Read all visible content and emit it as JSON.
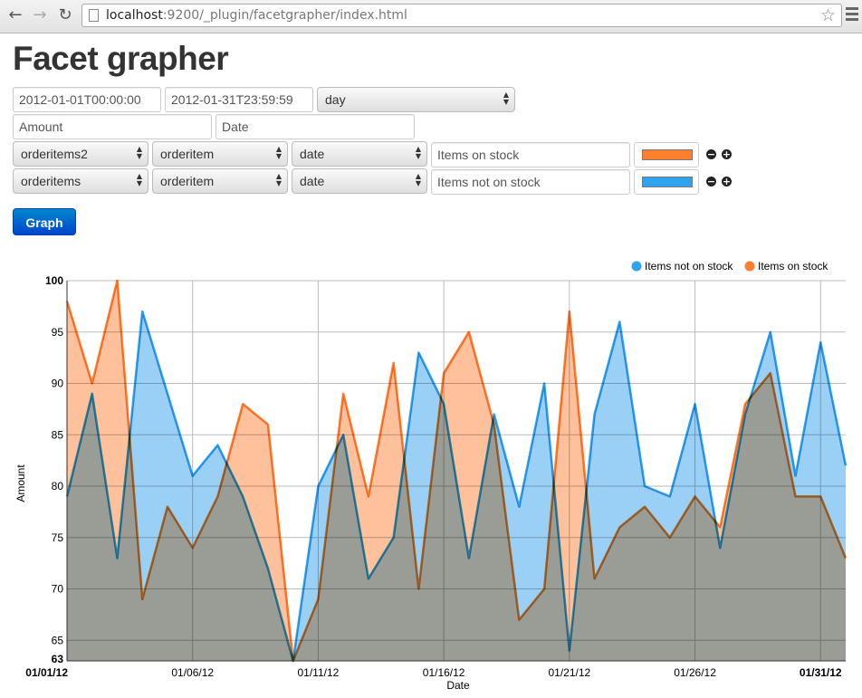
{
  "browser": {
    "url_host": "localhost",
    "url_rest": ":9200/_plugin/facetgrapher/index.html"
  },
  "page": {
    "title": "Facet grapher"
  },
  "form": {
    "start": "2012-01-01T00:00:00",
    "end": "2012-01-31T23:59:59",
    "interval": "day",
    "y_label": "Amount",
    "x_label": "Date",
    "rows": [
      {
        "index": "orderitems2",
        "type": "orderitem",
        "field": "date",
        "label": "Items on stock",
        "color": "#FE7F2C"
      },
      {
        "index": "orderitems",
        "type": "orderitem",
        "field": "date",
        "label": "Items not on stock",
        "color": "#2FA3EE"
      }
    ],
    "graph_label": "Graph"
  },
  "chart_data": {
    "type": "area",
    "ylabel": "Amount",
    "xlabel": "Date",
    "ylim": [
      63,
      100
    ],
    "yticks": [
      65,
      70,
      75,
      80,
      85,
      90,
      95
    ],
    "ymin_label": "63",
    "ymax_label": "100",
    "xlim": [
      1,
      31
    ],
    "xticks": [
      {
        "day": 1,
        "label": "01/01/12",
        "bold": true
      },
      {
        "day": 6,
        "label": "01/06/12",
        "bold": false
      },
      {
        "day": 11,
        "label": "01/11/12",
        "bold": false
      },
      {
        "day": 16,
        "label": "01/16/12",
        "bold": false
      },
      {
        "day": 21,
        "label": "01/21/12",
        "bold": false
      },
      {
        "day": 26,
        "label": "01/26/12",
        "bold": false
      },
      {
        "day": 31,
        "label": "01/31/12",
        "bold": true
      }
    ],
    "legend": "top-right",
    "series": [
      {
        "name": "Items not on stock",
        "color": "#2FA3EE",
        "fill": "#95CDF6",
        "values": [
          79,
          89,
          73,
          97,
          89,
          81,
          84,
          79,
          72,
          63,
          80,
          85,
          71,
          75,
          93,
          88,
          73,
          87,
          78,
          90,
          64,
          87,
          96,
          80,
          79,
          88,
          74,
          87,
          95,
          81,
          94,
          82
        ]
      },
      {
        "name": "Items on stock",
        "color": "#FE7F2C",
        "fill": "#FEBE96",
        "values": [
          98,
          90,
          100,
          69,
          78,
          74,
          79,
          88,
          86,
          63,
          69,
          89,
          79,
          92,
          70,
          91,
          95,
          86,
          67,
          70,
          97,
          71,
          76,
          78,
          75,
          79,
          76,
          88,
          91,
          79,
          79,
          73
        ]
      }
    ]
  }
}
